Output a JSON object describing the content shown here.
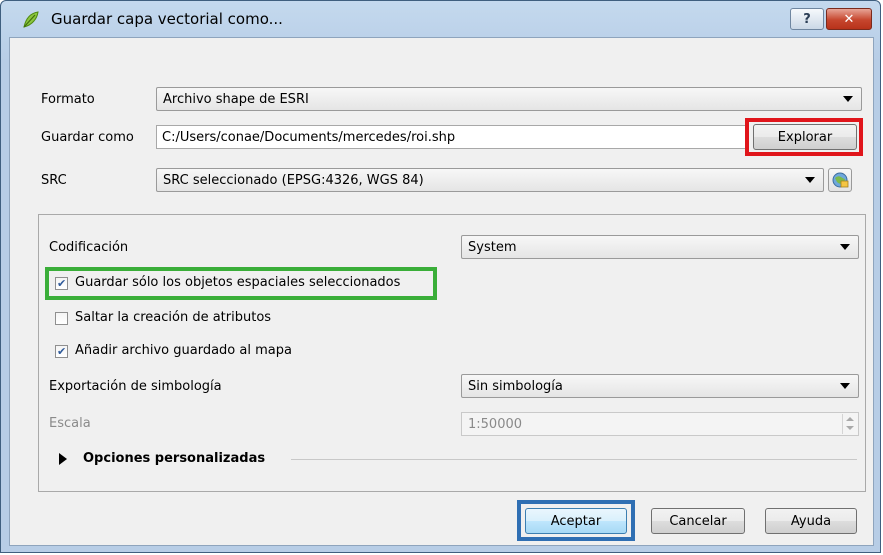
{
  "window": {
    "title": "Guardar capa vectorial como...",
    "help_label": "?",
    "close_label": "✕"
  },
  "form": {
    "format_label": "Formato",
    "format_value": "Archivo shape de ESRI",
    "save_as_label": "Guardar como",
    "save_as_value": "C:/Users/conae/Documents/mercedes/roi.shp",
    "browse_label": "Explorar",
    "crs_label": "SRC",
    "crs_value": "SRC seleccionado (EPSG:4326, WGS 84)"
  },
  "options": {
    "encoding_label": "Codificación",
    "encoding_value": "System",
    "save_selected_label": "Guardar sólo los objetos espaciales seleccionados",
    "save_selected_checked": true,
    "skip_attributes_label": "Saltar la creación de atributos",
    "skip_attributes_checked": false,
    "add_to_map_label": "Añadir archivo guardado al mapa",
    "add_to_map_checked": true,
    "symbology_label": "Exportación de simbología",
    "symbology_value": "Sin simbología",
    "scale_label": "Escala",
    "scale_value": "1:50000",
    "custom_options_label": "Opciones personalizadas"
  },
  "buttons": {
    "accept": "Aceptar",
    "cancel": "Cancelar",
    "help": "Ayuda"
  },
  "colors": {
    "highlight_red": "#e0151b",
    "highlight_green": "#3aae39",
    "highlight_blue": "#2f6fb3"
  }
}
